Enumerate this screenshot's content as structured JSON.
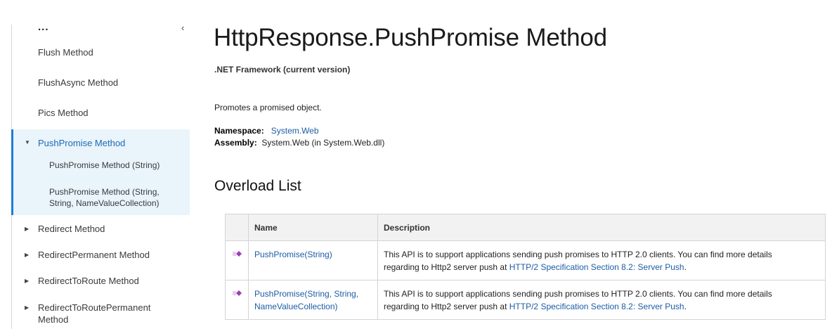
{
  "sidebar": {
    "ellipsis": "...",
    "collapse_glyph": "‹",
    "items": [
      {
        "label": "Flush Method"
      },
      {
        "label": "FlushAsync Method"
      },
      {
        "label": "Pics Method"
      }
    ],
    "active": {
      "label": "PushPromise Method",
      "children": [
        {
          "label": "PushPromise Method (String)"
        },
        {
          "line1": "PushPromise Method (String,",
          "line2": "String, NameValueCollection)"
        }
      ]
    },
    "more": [
      {
        "label": "Redirect Method"
      },
      {
        "label": "RedirectPermanent Method"
      },
      {
        "label": "RedirectToRoute Method"
      },
      {
        "line1": "RedirectToRoutePermanent",
        "line2": "Method"
      }
    ],
    "arrow_glyph": "▶",
    "arrow_down_glyph": "▼"
  },
  "main": {
    "title": "HttpResponse.PushPromise Method",
    "version": ".NET Framework (current version)",
    "summary": "Promotes a promised object.",
    "namespace_label": "Namespace:",
    "namespace_value": "System.Web",
    "assembly_label": "Assembly:",
    "assembly_value": "System.Web (in System.Web.dll)",
    "overload_heading": "Overload List",
    "table": {
      "headers": [
        "",
        "Name",
        "Description"
      ],
      "rows": [
        {
          "name_line1": "PushPromise(String)",
          "name_line2": "",
          "desc_line1": "This API is to support applications sending push promises to HTTP 2.0 clients. You can find more details",
          "desc_prefix": "regarding to Http2 server push at ",
          "desc_link": "HTTP/2 Specification Section 8.2: Server Push",
          "desc_suffix": "."
        },
        {
          "name_line1": "PushPromise(String,  String,",
          "name_line2": "NameValueCollection)",
          "desc_line1": "This API is to support applications sending push promises to HTTP 2.0 clients. You can find more details",
          "desc_prefix": "regarding to Http2 server push at ",
          "desc_link": "HTTP/2 Specification Section 8.2: Server Push",
          "desc_suffix": "."
        }
      ]
    }
  },
  "colors": {
    "accent": "#1d7ed4",
    "link": "#1d5ca6",
    "active_bg": "#e9f4fb",
    "method_icon": "#9b3fb5"
  },
  "icons": {
    "method": "method-icon"
  }
}
